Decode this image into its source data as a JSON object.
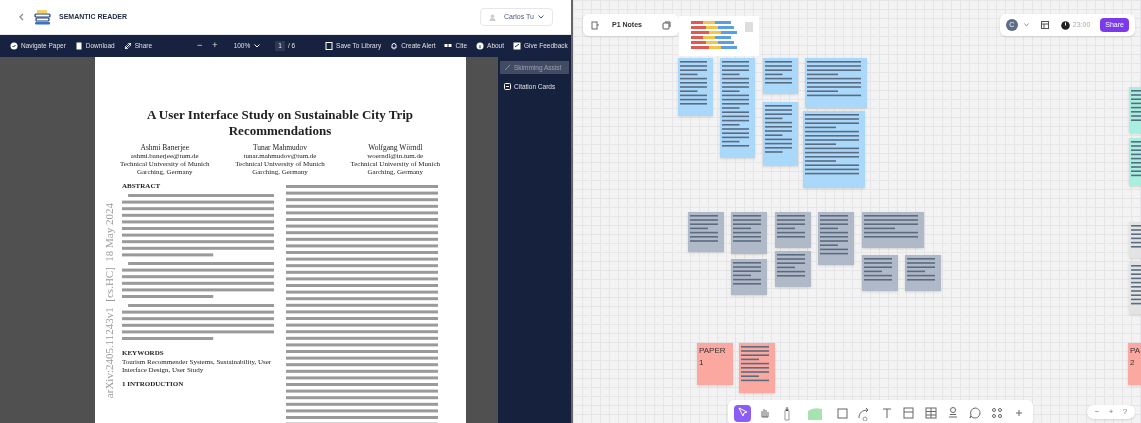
{
  "reader": {
    "brand": "SEMANTIC READER",
    "user": "Carlos Tu",
    "toolbar": [
      {
        "kind": "navigate",
        "label": "Navigate Paper"
      },
      {
        "kind": "download",
        "label": "Download"
      },
      {
        "kind": "share",
        "label": "Share"
      },
      {
        "kind": "zoom_out",
        "label": "−"
      },
      {
        "kind": "zoom_in",
        "label": "+"
      },
      {
        "kind": "zoom_level",
        "label": "100%"
      },
      {
        "kind": "page",
        "label": "1",
        "total": "/ 6"
      },
      {
        "kind": "save",
        "label": "Save To Library"
      },
      {
        "kind": "alert",
        "label": "Create Alert"
      },
      {
        "kind": "cite",
        "label": "Cite"
      },
      {
        "kind": "about",
        "label": "About"
      },
      {
        "kind": "feedback",
        "label": "Give Feedback"
      }
    ],
    "side_panel": [
      {
        "label": "Skimming Assist",
        "disabled": true
      },
      {
        "label": "Citation Cards",
        "disabled": false
      }
    ],
    "paper": {
      "title": "A User Interface Study on Sustainable City Trip Recommendations",
      "authors": [
        {
          "name": "Ashmi Banerjee",
          "email": "ashmi.banerjee@tum.de",
          "affiliation": "Technical University of Munich",
          "location": "Garching, Germany"
        },
        {
          "name": "Tunar Mahmudov",
          "email": "tunar.mahmudov@tum.de",
          "affiliation": "Technical University of Munich",
          "location": "Garching, Germany"
        },
        {
          "name": "Wolfgang Wörndl",
          "email": "woerndl@in.tum.de",
          "affiliation": "Technical University of Munich",
          "location": "Garching, Germany"
        }
      ],
      "side_stamp": "arXiv:2405.11243v1  [cs.HC]  18 May 2024",
      "left_column": [
        {
          "kind": "heading",
          "text": "ABSTRACT"
        },
        {
          "kind": "block"
        },
        {
          "kind": "block"
        },
        {
          "kind": "block"
        },
        {
          "kind": "heading",
          "text": "KEYWORDS"
        },
        {
          "kind": "text",
          "text": "Tourism Recommender Systems, Sustainability, User Interface Design, User Study"
        },
        {
          "kind": "heading",
          "text": "1   INTRODUCTION"
        }
      ],
      "right_column": [
        {
          "kind": "block"
        }
      ]
    }
  },
  "board": {
    "title": "P1 Notes",
    "timer": "23:00",
    "avatar": "C",
    "share": "Share",
    "notes": [
      {
        "color": "#a9d8fb"
      },
      {
        "color": "#a9d8fb"
      },
      {
        "color": "#a9d8fb"
      },
      {
        "color": "#a9d8fb"
      },
      {
        "color": "#a9d8fb"
      },
      {
        "color": "#a9d8fb"
      },
      {
        "color": "#a8efe0"
      },
      {
        "color": "#a8efe0"
      },
      {
        "color": "#b0b9c8"
      },
      {
        "color": "#b0b9c8"
      },
      {
        "color": "#b0b9c8"
      },
      {
        "color": "#b0b9c8"
      },
      {
        "color": "#b0b9c8"
      },
      {
        "color": "#b0b9c8"
      },
      {
        "color": "#b0b9c8"
      },
      {
        "color": "#b0b9c8"
      },
      {
        "color": "#b0b9c8"
      },
      {
        "color": "#e3e3e3"
      },
      {
        "color": "#e3e3e3"
      },
      {
        "color": "#fba9a0",
        "lines": [
          "PAPER",
          "1"
        ]
      },
      {
        "color": "#fba9a0"
      },
      {
        "color": "#fba9a0",
        "lines": [
          "PA",
          "2"
        ]
      }
    ],
    "tools": [
      {
        "kind": "select",
        "selected": true
      },
      {
        "kind": "hand",
        "selected": false
      },
      {
        "kind": "pen",
        "selected": false
      },
      {
        "kind": "sticky",
        "selected": false
      },
      {
        "kind": "shape",
        "selected": false
      },
      {
        "kind": "connector",
        "selected": false
      },
      {
        "kind": "text",
        "selected": false
      },
      {
        "kind": "frame",
        "selected": false
      },
      {
        "kind": "table",
        "selected": false
      },
      {
        "kind": "stamp",
        "selected": false
      },
      {
        "kind": "comment",
        "selected": false
      },
      {
        "kind": "apps",
        "selected": false
      },
      {
        "kind": "more",
        "selected": false
      }
    ],
    "zoom": [
      "−",
      "+",
      "?"
    ]
  }
}
